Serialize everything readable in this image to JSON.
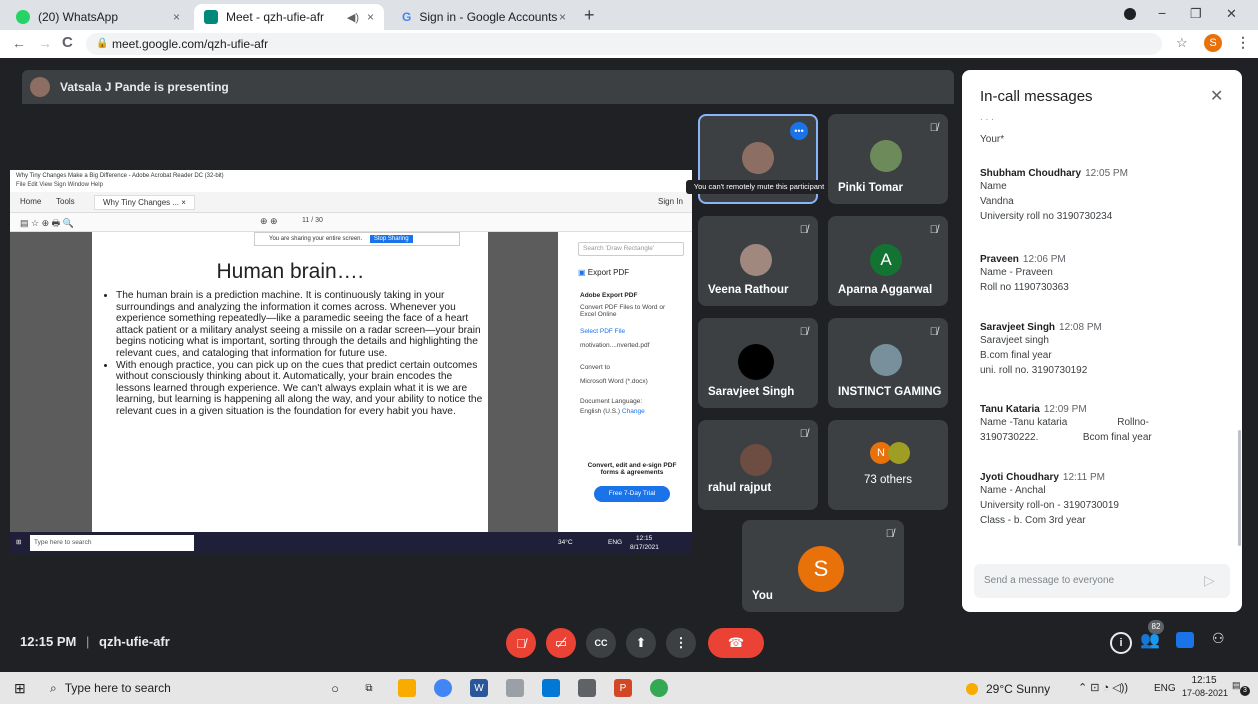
{
  "browser": {
    "tabs": [
      {
        "title": "(20) WhatsApp",
        "close": "×",
        "favicon_color": "#25d366",
        "badge": "20"
      },
      {
        "title": "Meet - qzh-ufie-afr",
        "close": "×",
        "favicon_color": "#00897b"
      },
      {
        "title": "Sign in - Google Accounts",
        "close": "×",
        "favicon_color": "#4285f4"
      }
    ],
    "new_tab": "+",
    "url": "meet.google.com/qzh-ufie-afr",
    "profile_initial": "S",
    "window_controls": {
      "minimize": "−",
      "restore": "❐",
      "close": "✕"
    }
  },
  "meet": {
    "presenter_text": "Vatsala J Pande is presenting",
    "meeting_time": "12:15 PM",
    "meeting_code": "qzh-ufie-afr",
    "participants_count": "82",
    "colors": {
      "accent": "#1a73e8",
      "danger": "#ea4335",
      "bg": "#202124",
      "tile": "#3c4043"
    }
  },
  "shared": {
    "title_bar": "Why Tiny Changes Make a Big Difference - Adobe Acrobat Reader DC (32-bit)",
    "menu": "File  Edit  View  Sign  Window  Help",
    "tabs": [
      "Home",
      "Tools",
      "Why Tiny Changes ... ×"
    ],
    "sign_in": "Sign In",
    "page_info": "11 / 30",
    "sharing_notice": "You are sharing your entire screen.",
    "stop_sharing": "Stop Sharing",
    "slide_title": "Human brain….",
    "bullets": [
      "The human brain is a prediction machine. It is continuously taking in your surroundings and analyzing the information it comes across. Whenever you experience something repeatedly—like a paramedic seeing the face of a heart attack patient or a military analyst seeing a missile on a radar screen—your brain begins noticing what is important, sorting through the details and highlighting the relevant cues, and cataloging that information for future use.",
      "With enough practice, you can pick up on the cues that predict certain outcomes without consciously thinking about it. Automatically, your brain encodes the lessons learned through experience. We can't always explain what it is we are learning, but learning is happening all along the way, and your ability to notice the relevant cues in a given situation is the foundation for every habit you have."
    ],
    "side_panel": {
      "search_placeholder": "Search 'Draw Rectangle'",
      "export_pdf": "Export PDF",
      "adobe_export_pdf": "Adobe Export PDF",
      "convert_desc": "Convert PDF Files to Word or Excel Online",
      "select_pdf": "Select PDF File",
      "file_name": "motivation....nverted.pdf",
      "convert_to": "Convert to",
      "format": "Microsoft Word (*.docx)",
      "doc_language": "Document Language:",
      "language": "English (U.S.)",
      "change": "Change",
      "promo": "Convert, edit and e-sign PDF forms & agreements",
      "trial": "Free 7-Day Trial"
    },
    "taskbar": {
      "search": "Type here to search",
      "weather": "34°C",
      "lang": "ENG",
      "time": "12:15",
      "date": "8/17/2021"
    }
  },
  "tiles": [
    {
      "name": "",
      "tooltip": "You can't remotely mute this participant",
      "avatar_color": "#8d6e63",
      "highlight": true
    },
    {
      "name": "Pinki Tomar",
      "avatar_color": "#6d8b5a"
    },
    {
      "name": "Veena Rathour",
      "avatar_color": "#a1887f"
    },
    {
      "name": "Aparna Aggarwal",
      "initial": "A",
      "avatar_color": "#137333"
    },
    {
      "name": "Saravjeet Singh",
      "avatar_color": "#000000"
    },
    {
      "name": "INSTINCT GAMING",
      "avatar_color": "#78909c"
    },
    {
      "name": "rahul rajput",
      "avatar_color": "#6d4c41"
    },
    {
      "name": "73 others",
      "initial": "N",
      "avatar_color": "#e8710a"
    },
    {
      "name": "You",
      "initial": "S",
      "avatar_color": "#e8710a"
    }
  ],
  "chat": {
    "title": "In-call messages",
    "close": "✕",
    "faded_text": ". .  .",
    "your_text": "Your*",
    "messages": [
      {
        "sender": "Shubham Choudhary",
        "time": "12:05 PM",
        "lines": [
          "Name",
          "Vandna",
          "University roll no 3190730234"
        ]
      },
      {
        "sender": "Praveen",
        "time": "12:06 PM",
        "lines": [
          "Name - Praveen",
          "Roll no 1190730363"
        ]
      },
      {
        "sender": "Saravjeet Singh",
        "time": "12:08 PM",
        "lines": [
          "Saravjeet singh",
          "B.com final year",
          "uni. roll no. 3190730192"
        ]
      },
      {
        "sender": "Tanu Kataria",
        "time": "12:09 PM",
        "lines": [
          "Name -Tanu kataria                  Rollno-",
          "3190730222.                Bcom final year"
        ]
      },
      {
        "sender": "Jyoti Choudhary",
        "time": "12:11 PM",
        "lines": [
          "Name - Anchal",
          "University roll-on - 3190730019",
          "Class - b. Com 3rd year"
        ]
      }
    ],
    "input_placeholder": "Send a message to everyone"
  },
  "taskbar": {
    "search": "Type here to search",
    "weather": "29°C  Sunny",
    "lang": "ENG",
    "time": "12:15",
    "date": "17-08-2021",
    "notif": "3"
  }
}
